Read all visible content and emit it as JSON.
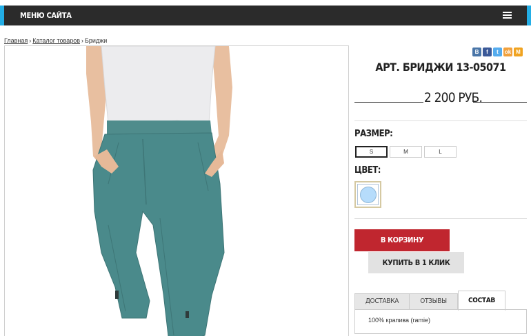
{
  "topbar": {
    "menu_label": "МЕНЮ САЙТА"
  },
  "breadcrumb": {
    "home": "Главная",
    "catalog": "Каталог товаров",
    "sep": "›",
    "current": "Бриджи"
  },
  "social": [
    {
      "label": "В",
      "name": "vk-icon",
      "color": "#4a76a8"
    },
    {
      "label": "f",
      "name": "facebook-icon",
      "color": "#3b5998"
    },
    {
      "label": "t",
      "name": "twitter-icon",
      "color": "#55acee"
    },
    {
      "label": "ok",
      "name": "odnoklassniki-icon",
      "color": "#f2a13c"
    },
    {
      "label": "M",
      "name": "mailru-icon",
      "color": "#f0a320"
    }
  ],
  "product": {
    "article": "АРТ. БРИДЖИ 13-05071",
    "price": "2 200 РУБ.",
    "size_label": "РАЗМЕР:",
    "sizes": [
      "S",
      "M",
      "L"
    ],
    "selected_size": "S",
    "color_label": "ЦВЕТ:",
    "swatch_color": "#b6dcfb"
  },
  "actions": {
    "cart": "В КОРЗИНУ",
    "one_click": "КУПИТЬ В 1 КЛИК"
  },
  "tabs": [
    "ДОСТАВКА",
    "ОТЗЫВЫ",
    "СОСТАВ"
  ],
  "active_tab": "СОСТАВ",
  "composition": "100% крапива (ramie)"
}
